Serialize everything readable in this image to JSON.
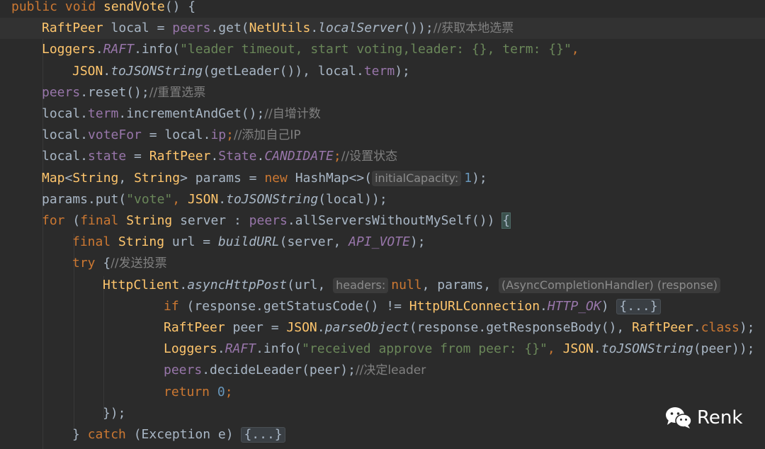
{
  "editor": {
    "lines": [
      [
        {
          "t": "public ",
          "c": "k"
        },
        {
          "t": "void ",
          "c": "k"
        },
        {
          "t": "sendVote",
          "c": "f"
        },
        {
          "t": "() {",
          "c": "t"
        }
      ],
      [
        {
          "t": "RaftPeer ",
          "c": "f"
        },
        {
          "t": "local = ",
          "c": "t"
        },
        {
          "t": "peers",
          "c": "m"
        },
        {
          "t": ".get(",
          "c": "t"
        },
        {
          "t": "NetUtils",
          "c": "f"
        },
        {
          "t": ".",
          "c": "t"
        },
        {
          "t": "localServer",
          "c": "ci"
        },
        {
          "t": "());",
          "c": "t"
        },
        {
          "t": "//获取本地选票",
          "c": "c"
        }
      ],
      [
        {
          "t": "Loggers",
          "c": "f"
        },
        {
          "t": ".",
          "c": "t"
        },
        {
          "t": "RAFT",
          "c": "mi"
        },
        {
          "t": ".info(",
          "c": "t"
        },
        {
          "t": "\"leader timeout, start voting,leader: {}, term: {}\"",
          "c": "s"
        },
        {
          "t": ",",
          "c": "k"
        }
      ],
      [
        {
          "t": "JSON",
          "c": "f"
        },
        {
          "t": ".",
          "c": "t"
        },
        {
          "t": "toJSONString",
          "c": "ci"
        },
        {
          "t": "(getLeader()), local.",
          "c": "t"
        },
        {
          "t": "term",
          "c": "m"
        },
        {
          "t": ");",
          "c": "t"
        }
      ],
      [
        {
          "t": "peers",
          "c": "m"
        },
        {
          "t": ".reset();",
          "c": "t"
        },
        {
          "t": "//重置选票",
          "c": "c"
        }
      ],
      [
        {
          "t": "local.",
          "c": "t"
        },
        {
          "t": "term",
          "c": "m"
        },
        {
          "t": ".incrementAndGet();",
          "c": "t"
        },
        {
          "t": "//自增计数",
          "c": "c"
        }
      ],
      [
        {
          "t": "local.",
          "c": "t"
        },
        {
          "t": "voteFor",
          "c": "m"
        },
        {
          "t": " = local.",
          "c": "t"
        },
        {
          "t": "ip",
          "c": "m"
        },
        {
          "t": ";",
          "c": "k"
        },
        {
          "t": "//添加自己IP",
          "c": "c"
        }
      ],
      [
        {
          "t": "local.",
          "c": "t"
        },
        {
          "t": "state",
          "c": "m"
        },
        {
          "t": " = ",
          "c": "t"
        },
        {
          "t": "RaftPeer",
          "c": "f"
        },
        {
          "t": ".",
          "c": "t"
        },
        {
          "t": "State",
          "c": "m"
        },
        {
          "t": ".",
          "c": "t"
        },
        {
          "t": "CANDIDATE",
          "c": "mi"
        },
        {
          "t": ";",
          "c": "k"
        },
        {
          "t": "//设置状态",
          "c": "c"
        }
      ],
      [
        {
          "t": "Map",
          "c": "f"
        },
        {
          "t": "<",
          "c": "t"
        },
        {
          "t": "String",
          "c": "f"
        },
        {
          "t": ", ",
          "c": "t"
        },
        {
          "t": "String",
          "c": "f"
        },
        {
          "t": "> params = ",
          "c": "t"
        },
        {
          "t": "new ",
          "c": "k"
        },
        {
          "t": "HashMap<>(",
          "c": "t"
        },
        {
          "t": "initialCapacity:",
          "c": "hint"
        },
        {
          "t": "1",
          "c": "n"
        },
        {
          "t": ");",
          "c": "t"
        }
      ],
      [
        {
          "t": "params.put(",
          "c": "t"
        },
        {
          "t": "\"vote\"",
          "c": "s"
        },
        {
          "t": ", ",
          "c": "k"
        },
        {
          "t": "JSON",
          "c": "f"
        },
        {
          "t": ".",
          "c": "t"
        },
        {
          "t": "toJSONString",
          "c": "ci"
        },
        {
          "t": "(local));",
          "c": "t"
        }
      ],
      [
        {
          "t": "for ",
          "c": "k"
        },
        {
          "t": "(",
          "c": "t"
        },
        {
          "t": "final ",
          "c": "k"
        },
        {
          "t": "String ",
          "c": "f"
        },
        {
          "t": "server : ",
          "c": "t"
        },
        {
          "t": "peers",
          "c": "m"
        },
        {
          "t": ".allServersWithoutMySelf()) ",
          "c": "t"
        },
        {
          "t": "{",
          "c": "bracket"
        }
      ],
      [
        {
          "t": "final ",
          "c": "k"
        },
        {
          "t": "String ",
          "c": "f"
        },
        {
          "t": "url = ",
          "c": "t"
        },
        {
          "t": "buildURL",
          "c": "ci"
        },
        {
          "t": "(server, ",
          "c": "t"
        },
        {
          "t": "API_VOTE",
          "c": "mi"
        },
        {
          "t": ");",
          "c": "t"
        }
      ],
      [
        {
          "t": "try ",
          "c": "k"
        },
        {
          "t": "{",
          "c": "t"
        },
        {
          "t": "//发送投票",
          "c": "c"
        }
      ],
      [
        {
          "t": "HttpClient",
          "c": "f"
        },
        {
          "t": ".",
          "c": "t"
        },
        {
          "t": "asyncHttpPost",
          "c": "ci"
        },
        {
          "t": "(url, ",
          "c": "t"
        },
        {
          "t": "headers:",
          "c": "hint"
        },
        {
          "t": "null",
          "c": "k"
        },
        {
          "t": ", params, ",
          "c": "t"
        },
        {
          "t": "(AsyncCompletionHandler) (response)",
          "c": "hint"
        }
      ],
      [
        {
          "t": "if ",
          "c": "k"
        },
        {
          "t": "(response.getStatusCode() != ",
          "c": "t"
        },
        {
          "t": "HttpURLConnection",
          "c": "f"
        },
        {
          "t": ".",
          "c": "t"
        },
        {
          "t": "HTTP_OK",
          "c": "mi"
        },
        {
          "t": ") ",
          "c": "t"
        },
        {
          "t": "{...}",
          "c": "fold"
        }
      ],
      [
        {
          "t": "RaftPeer ",
          "c": "f"
        },
        {
          "t": "peer = ",
          "c": "t"
        },
        {
          "t": "JSON",
          "c": "f"
        },
        {
          "t": ".",
          "c": "t"
        },
        {
          "t": "parseObject",
          "c": "ci"
        },
        {
          "t": "(response.getResponseBody(), ",
          "c": "t"
        },
        {
          "t": "RaftPeer",
          "c": "f"
        },
        {
          "t": ".",
          "c": "t"
        },
        {
          "t": "class",
          "c": "k"
        },
        {
          "t": ");",
          "c": "t"
        }
      ],
      [
        {
          "t": "Loggers",
          "c": "f"
        },
        {
          "t": ".",
          "c": "t"
        },
        {
          "t": "RAFT",
          "c": "mi"
        },
        {
          "t": ".info(",
          "c": "t"
        },
        {
          "t": "\"received approve from peer: {}\"",
          "c": "s"
        },
        {
          "t": ", ",
          "c": "k"
        },
        {
          "t": "JSON",
          "c": "f"
        },
        {
          "t": ".",
          "c": "t"
        },
        {
          "t": "toJSONString",
          "c": "ci"
        },
        {
          "t": "(peer));",
          "c": "t"
        }
      ],
      [
        {
          "t": "peers",
          "c": "m"
        },
        {
          "t": ".decideLeader(peer);",
          "c": "t"
        },
        {
          "t": "//决定leader",
          "c": "c"
        }
      ],
      [
        {
          "t": "return ",
          "c": "k"
        },
        {
          "t": "0",
          "c": "n"
        },
        {
          "t": ";",
          "c": "k"
        }
      ],
      [
        {
          "t": "});",
          "c": "t"
        }
      ],
      [
        {
          "t": "} ",
          "c": "t"
        },
        {
          "t": "catch ",
          "c": "k"
        },
        {
          "t": "(Exception e) ",
          "c": "t"
        },
        {
          "t": "{...}",
          "c": "fold"
        }
      ]
    ]
  },
  "watermark": {
    "text": "Renk",
    "icon": "wechat-icon"
  }
}
